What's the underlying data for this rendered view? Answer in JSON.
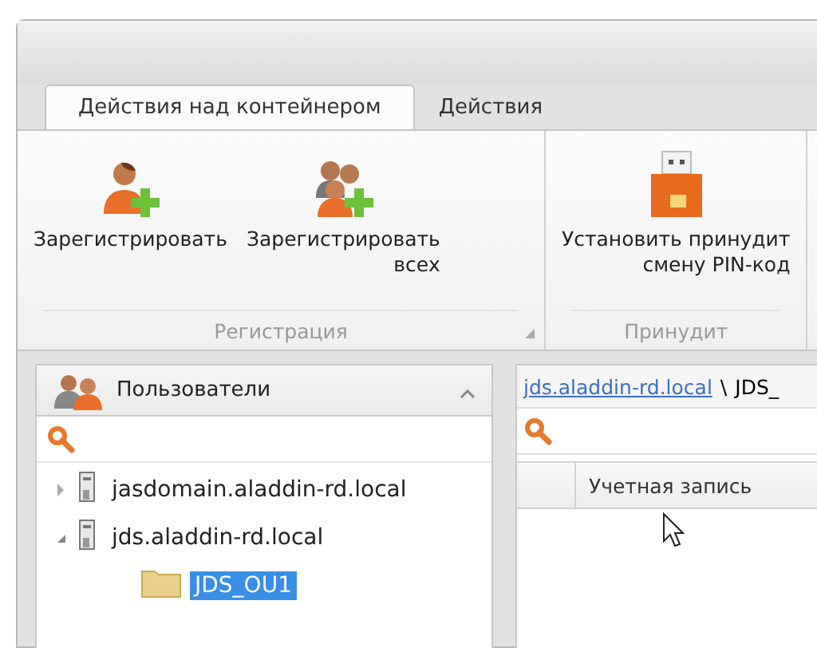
{
  "tabs": [
    {
      "label": "Действия над контейнером",
      "selected": true
    },
    {
      "label": "Действия",
      "selected": false
    }
  ],
  "ribbon_groups": [
    {
      "label": "Регистрация",
      "launcher": true,
      "buttons": [
        {
          "kind": "user-add",
          "lines": [
            "Зарегистрировать"
          ]
        },
        {
          "kind": "users-add",
          "lines": [
            "Зарегистрировать",
            "всех"
          ]
        }
      ]
    },
    {
      "label": "Принудит",
      "launcher": false,
      "buttons": [
        {
          "kind": "token",
          "lines": [
            "Установить принудит",
            "смену PIN-код"
          ]
        }
      ]
    }
  ],
  "users_panel": {
    "title": "Пользователи",
    "expanded": true,
    "tree": [
      {
        "label": "jasdomain.aladdin-rd.local",
        "kind": "domain",
        "expanded": false,
        "selected": false
      },
      {
        "label": "jds.aladdin-rd.local",
        "kind": "domain",
        "expanded": true,
        "selected": false,
        "children": [
          {
            "label": "JDS_OU1",
            "kind": "folder",
            "selected": true
          }
        ]
      }
    ]
  },
  "content": {
    "breadcrumb": [
      {
        "label": "jds.aladdin-rd.local",
        "kind": "link"
      },
      {
        "label": "\\",
        "kind": "separator"
      },
      {
        "label": "JDS_",
        "kind": "text"
      }
    ],
    "table": {
      "columns": [
        {
          "label": "Учетная запись"
        }
      ]
    }
  }
}
